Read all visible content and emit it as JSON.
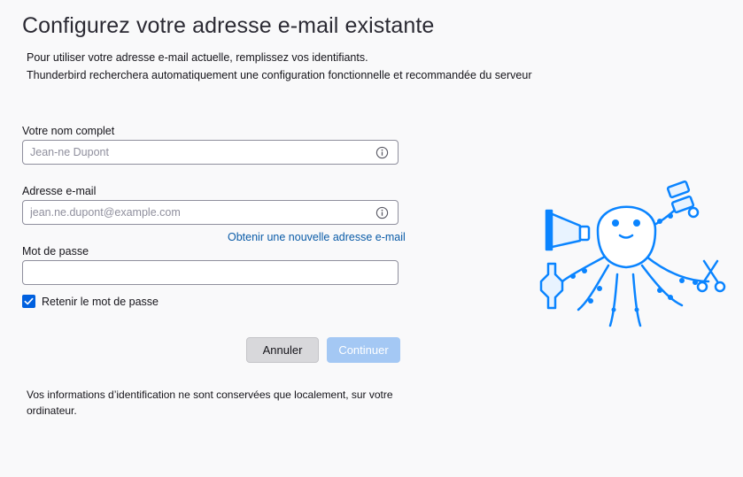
{
  "header": {
    "title": "Configurez votre adresse e-mail existante",
    "intro_line1": "Pour utiliser votre adresse e-mail actuelle, remplissez vos identifiants.",
    "intro_line2": "Thunderbird recherchera automatiquement une configuration fonctionnelle et recommandée du serveur"
  },
  "form": {
    "name_label": "Votre nom complet",
    "name_placeholder": "Jean-ne Dupont",
    "name_value": "",
    "email_label": "Adresse e-mail",
    "email_placeholder": "jean.ne.dupont@example.com",
    "email_value": "",
    "new_address_link": "Obtenir une nouvelle adresse e-mail",
    "password_label": "Mot de passe",
    "password_value": "",
    "remember_label": "Retenir le mot de passe",
    "remember_checked": true
  },
  "buttons": {
    "cancel_label": "Annuler",
    "continue_label": "Continuer"
  },
  "footer": {
    "note": "Vos informations d’identification ne sont conservées que localement, sur votre ordinateur."
  },
  "icons": {
    "info": "info-icon",
    "checkmark": "checkmark-icon",
    "mascot": "thunderbird-octopus-illustration"
  },
  "colors": {
    "accent": "#0060df",
    "link": "#0b5ca8",
    "continue_disabled": "#a4c8f4",
    "mascot_blue": "#0a84ff"
  }
}
